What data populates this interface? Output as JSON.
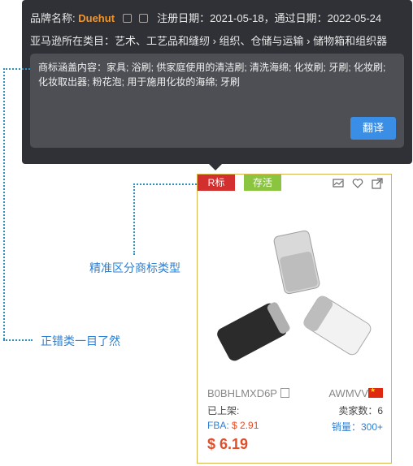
{
  "tooltip": {
    "brand_label": "品牌名称:",
    "brand_name": "Duehut",
    "dates": "注册日期：2021-05-18，通过日期：2022-05-24",
    "category": "亚马逊所在类目：艺术、工艺品和缝纫 › 组织、仓储与运输 › 储物箱和组织器",
    "coverage": "商标涵盖内容：家具; 浴刷; 供家庭使用的清洁刷; 清洗海绵; 化妆刷; 牙刷; 化妆刷; 化妆取出器; 粉花泡; 用于施用化妆的海绵; 牙刷",
    "translate_button": "翻译"
  },
  "annotations": {
    "precise": "精准区分商标类型",
    "clear": "正错类一目了然"
  },
  "card": {
    "tag_r": "R标",
    "tag_live": "存活",
    "asin": "B0BHLMXD6P",
    "seller": "AWMVV",
    "listed_label": "已上架:",
    "sellers_count": "卖家数：6",
    "fba_label": "FBA:",
    "fba_value": "$ 2.91",
    "sales": "销量：300+",
    "price": "$ 6.19"
  },
  "colors": {
    "accent": "#3a8ee6",
    "price": "#e04e2a",
    "brand": "#f0962d"
  },
  "icons": [
    "copy-icon",
    "external-link-icon",
    "chart-icon",
    "heart-icon",
    "share-icon",
    "china-flag-icon"
  ]
}
